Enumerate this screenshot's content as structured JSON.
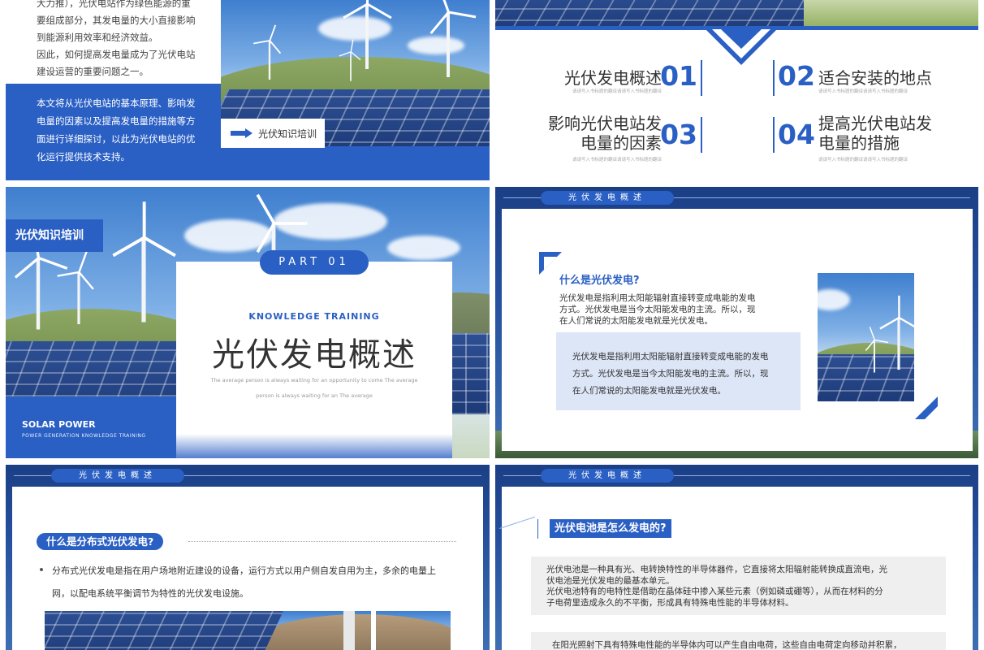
{
  "slide1": {
    "para_lines": [
      "大力推），光伏电站作为绿色能源的重",
      "要组成部分，其发电量的大小直接影响",
      "到能源利用效率和经济效益。",
      "因此，如何提高发电量成为了光伏电站",
      "建设运营的重要问题之一。"
    ],
    "blue_para_lines": [
      "本文将从光伏电站的基本原理、影响发",
      "电量的因素以及提高发电量的措施等方",
      "面进行详细探讨，以此为光伏电站的优",
      "化运行提供技术支持。"
    ],
    "tag_label": "光伏知识培训"
  },
  "slide2": {
    "items": [
      {
        "title": "光伏发电概述",
        "num": "01",
        "sub": "请请写入书标题的翻译请请写入书标题的翻译"
      },
      {
        "title": "适合安装的地点",
        "num": "02",
        "sub": "请请写入书标题的翻译请请写入书标题的翻译"
      },
      {
        "title": "影响光伏电站发电量的因素",
        "title_l1": "影响光伏电站发",
        "title_l2": "电量的因素",
        "num": "03",
        "sub": "请请写入书标题的翻译请请写入书标题的翻译"
      },
      {
        "title": "提高光伏电站发电量的措施",
        "title_l1": "提高光伏电站发",
        "title_l2": "电量的措施",
        "num": "04",
        "sub": "请请写入书标题的翻译请请写入书标题的翻译"
      }
    ]
  },
  "slide3": {
    "tag": "光伏知识培训",
    "part": "PART 01",
    "kt": "KNOWLEDGE TRAINING",
    "title": "光伏发电概述",
    "desc_l1": "The average person is always waiting for an opportunity to come The average",
    "desc_l2": "person is always waiting for an The average",
    "solar": "SOLAR POWER",
    "solar_sub": "POWER GENERATION KNOWLEDGE TRAINING"
  },
  "slide4": {
    "pill": "光伏发电概述",
    "q": "什么是光伏发电?",
    "p_lines": [
      "光伏发电是指利用太阳能辐射直接转变成电能的发电",
      "方式。光伏发电是当今太阳能发电的主流。所以，现",
      "在人们常说的太阳能发电就是光伏发电。"
    ],
    "box_lines": [
      "光伏发电是指利用太阳能辐射直接转变成电能的发电",
      "方式。光伏发电是当今太阳能发电的主流。所以，现",
      "在人们常说的太阳能发电就是光伏发电。"
    ]
  },
  "slide5": {
    "pill": "光伏发电概述",
    "q": "什么是分布式光伏发电?",
    "bullet_l1": "分布式光伏发电是指在用户场地附近建设的设备，运行方式以用户侧自发自用为主，多余的电量上",
    "bullet_l2": "网，以配电系统平衡调节为特性的光伏发电设施。"
  },
  "slide6": {
    "pill": "光伏发电概述",
    "q": "光伏电池是怎么发电的?",
    "box_lines": [
      "光伏电池是一种具有光、电转换特性的半导体器件，它直接将太阳辐射能转换成直流电，光",
      "伏电池是光伏发电的最基本单元。",
      "光伏电池特有的电特性是借助在晶体硅中掺入某些元素（例如磷或硼等），从而在材料的分",
      "子电荷里造成永久的不平衡，形成具有特殊电性能的半导体材料。"
    ],
    "box2_l1": "在阳光照射下具有特殊电性能的半导体内可以产生自由电荷，这些自由电荷定向移动并积累，"
  },
  "colors": {
    "accent": "#2a5fc4",
    "dark": "#1d3a78"
  }
}
